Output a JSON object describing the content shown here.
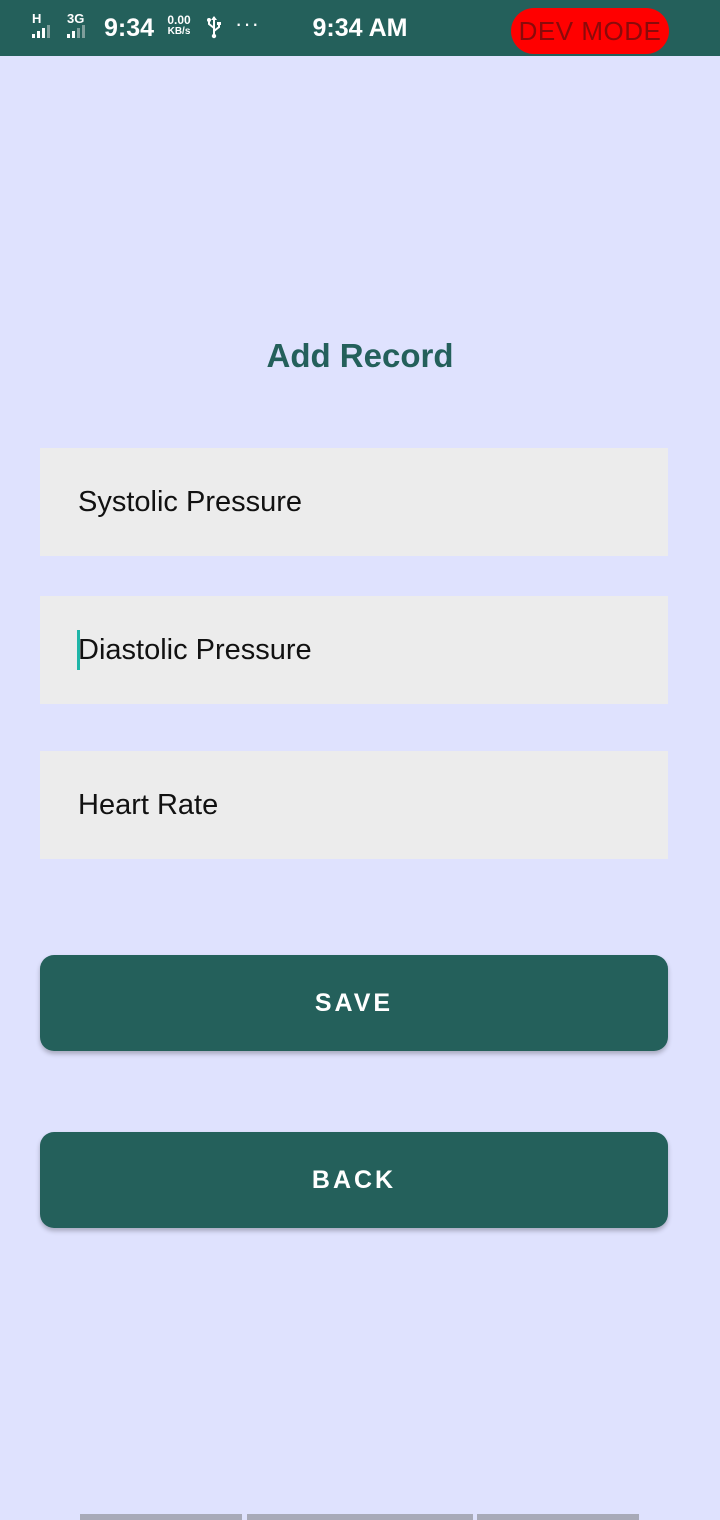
{
  "status_bar": {
    "signal1_label": "H",
    "signal2_label": "3G",
    "time_left": "9:34",
    "speed_value": "0.00",
    "speed_unit": "KB/s",
    "more": "···",
    "time_center": "9:34 AM",
    "dev_badge": "DEV MODE"
  },
  "page": {
    "title": "Add Record"
  },
  "form": {
    "systolic_placeholder": "Systolic Pressure",
    "diastolic_placeholder": "Diastolic Pressure",
    "heart_rate_placeholder": "Heart Rate"
  },
  "buttons": {
    "save_label": "SAVE",
    "back_label": "BACK"
  },
  "colors": {
    "background": "#dfe2fe",
    "primary": "#24605b",
    "field_bg": "#ececec",
    "dev_badge": "#ff0000",
    "cursor": "#1fb5a8"
  },
  "icons": {
    "signal": "signal-bars-icon",
    "usb": "usb-icon",
    "more": "more-dots-icon"
  }
}
